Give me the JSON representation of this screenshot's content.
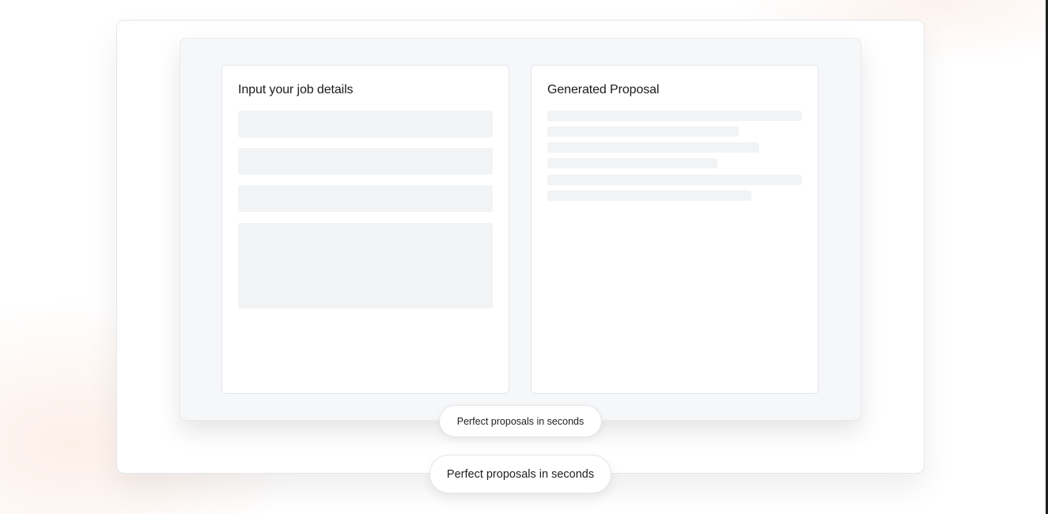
{
  "input_card": {
    "title": "Input your job details",
    "field_placeholders": [
      "",
      "",
      "",
      ""
    ]
  },
  "proposal_card": {
    "title": "Generated Proposal",
    "line_count": 6
  },
  "tagline": {
    "inner_badge": "Perfect proposals in seconds",
    "outer_badge": "Perfect proposals in seconds"
  },
  "colors": {
    "background": "#ffffff",
    "panel": "#f6f7f9",
    "skeleton": "#f2f3f5",
    "text": "#1b1b1f"
  }
}
